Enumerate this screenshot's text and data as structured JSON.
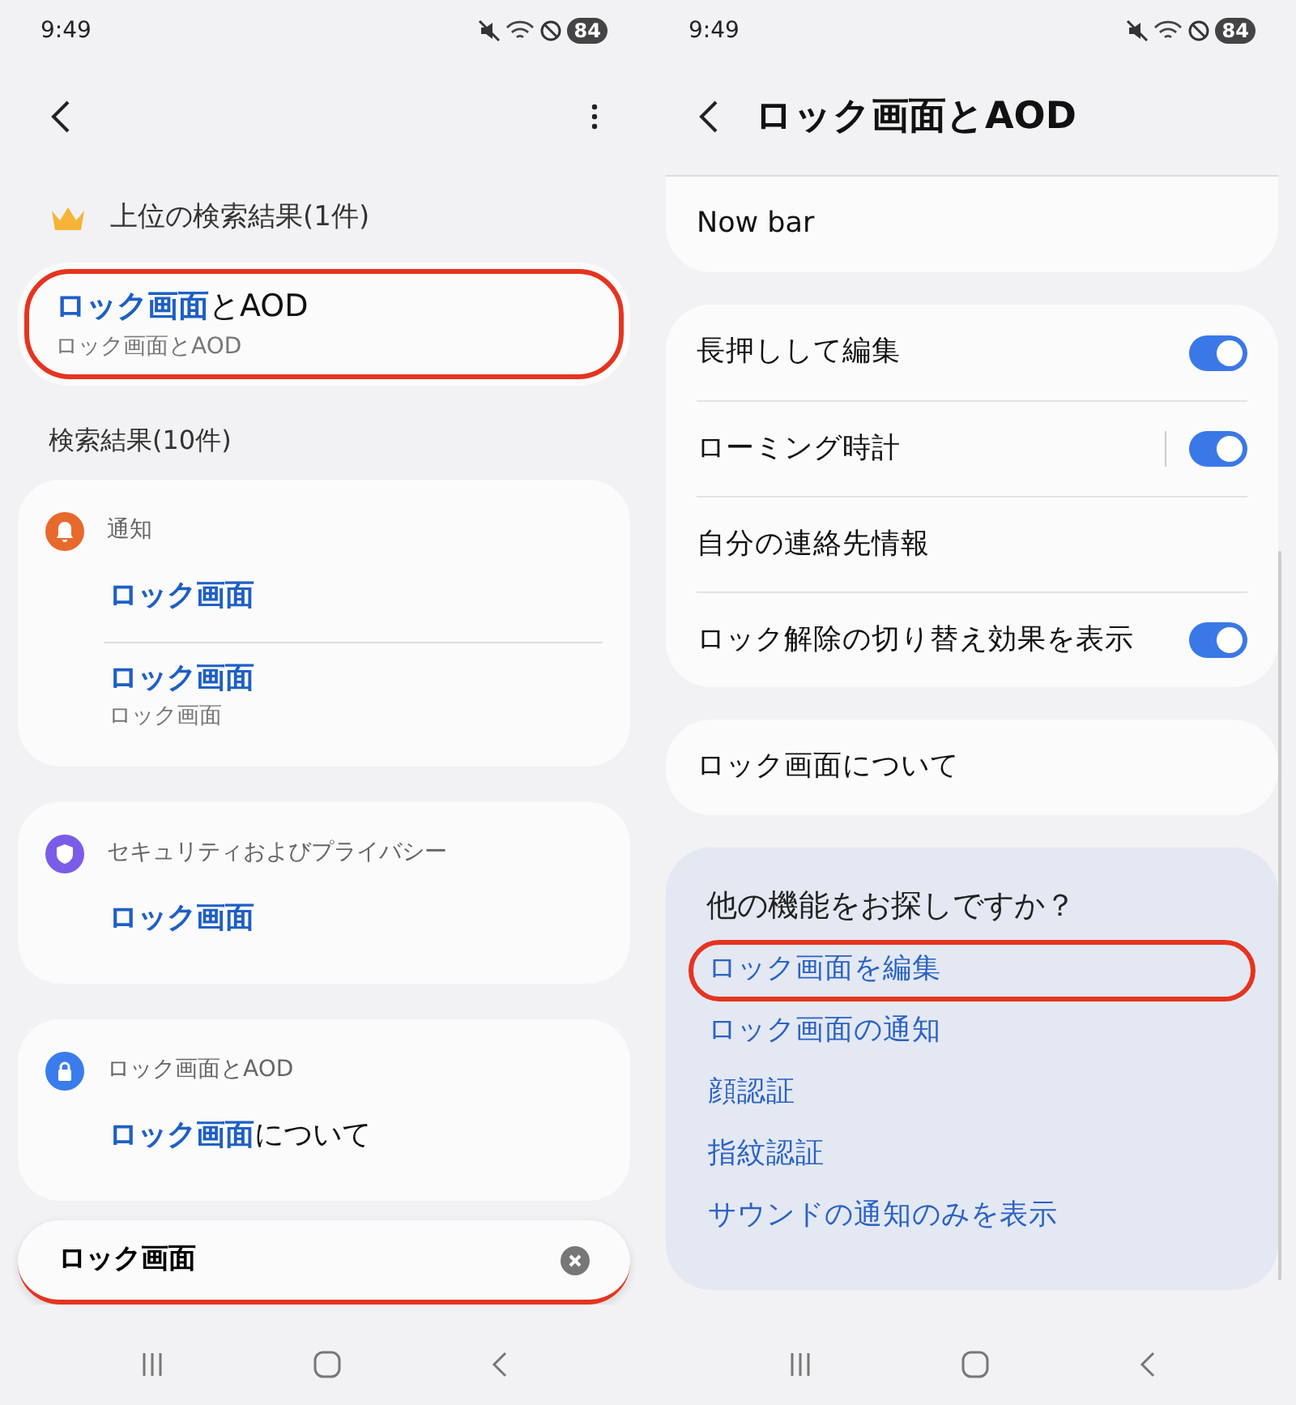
{
  "left": {
    "status_bar": {
      "time": "9:49",
      "battery": "84"
    },
    "top_results": {
      "title": "上位の検索結果(1件)",
      "items": [
        {
          "title": "**ロック画面**とAOD",
          "subtitle": "ロック画面とAOD",
          "highlighted": true
        }
      ]
    },
    "results": {
      "title": "検索結果(10件)",
      "groups": [
        {
          "category": "通知",
          "color": "#e8692c",
          "items": [
            {
              "title": "ロック画面",
              "matched": true
            },
            {
              "title": "ロック画面",
              "matched": true,
              "subtitle": "ロック画面"
            }
          ]
        },
        {
          "category": "セキュリティおよびプライバシー",
          "color": "#7b5ce8",
          "items": [
            {
              "title": "ロック画面",
              "matched": true
            }
          ]
        },
        {
          "category": "ロック画面とAOD",
          "color": "#3b7cec",
          "items": [
            {
              "title": "**ロック画面**について",
              "matched": false
            }
          ]
        }
      ]
    },
    "search": {
      "value": "ロック画面"
    }
  },
  "right": {
    "status_bar": {
      "time": "9:49",
      "battery": "84"
    },
    "title": "ロック画面とAOD",
    "cards": [
      {
        "rows": [
          {
            "kind": "plain",
            "label": "Now bar"
          }
        ]
      },
      {
        "rows": [
          {
            "kind": "switch",
            "label": "長押しして編集",
            "on": true,
            "split": false
          },
          {
            "kind": "switch",
            "label": "ローミング時計",
            "on": true,
            "split": true
          },
          {
            "kind": "plain",
            "label": "自分の連絡先情報"
          },
          {
            "kind": "switch",
            "label": "ロック解除の切り替え効果を表示",
            "on": true,
            "split": false
          }
        ]
      },
      {
        "rows": [
          {
            "kind": "plain",
            "label": "ロック画面について"
          }
        ]
      }
    ],
    "suggestions": {
      "title": "他の機能をお探しですか？",
      "links": [
        {
          "label": "ロック画面を編集",
          "highlighted": true
        },
        {
          "label": "ロック画面の通知",
          "highlighted": false
        },
        {
          "label": "顔認証",
          "highlighted": false
        },
        {
          "label": "指紋認証",
          "highlighted": false
        },
        {
          "label": "サウンドの通知のみを表示",
          "highlighted": false
        }
      ]
    }
  }
}
